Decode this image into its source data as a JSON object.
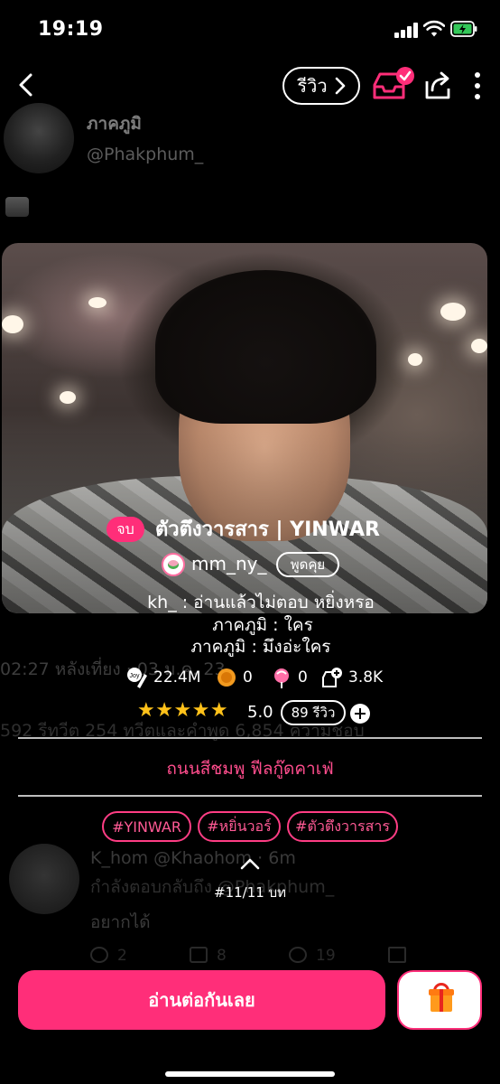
{
  "status_bar": {
    "time": "19:19"
  },
  "nav": {
    "review_label": "รีวิว"
  },
  "background_tweet": {
    "name": "ภาคภูมิ",
    "handle": "@Phakphum_",
    "meta_line": "02:27 หลังเที่ยง · 03 ม.ค. 23",
    "stats_line": "592 รีทวีต  254 ทวีตและคำพูด  6,854 ความชอบ",
    "reply_name": "K_hom @Khaohom · 6m",
    "reply_to": "กำลังตอบกลับถึง @Phakphum_",
    "reply_text": "อยากได้",
    "reply_counts": [
      "2",
      "8",
      "19"
    ]
  },
  "novel": {
    "status_badge": "จบ",
    "title": "ตัวตึงวารสาร | YINWAR",
    "author": "mm_ny_",
    "chat_label": "พูดคุย",
    "dialog": [
      "kh_ : อ่านแล้วไม่ตอบ หยิ่งหรอ",
      "ภาคภูมิ : ใคร",
      "ภาคภูมิ : มึงอ่ะใคร"
    ],
    "stats": {
      "views": "22.4M",
      "coins": "0",
      "candies": "0",
      "library_adds": "3.8K"
    },
    "rating": {
      "stars": "★★★★★",
      "value": "5.0",
      "review_count": "89 รีวิว"
    },
    "subtitle": "ถนนสีชมพู  ฟีลกู๊ดคาเฟ่",
    "tags": [
      "#YINWAR",
      "#หยิ่นวอร์",
      "#ตัวตึงวารสาร"
    ],
    "chapter_count": "#11/11 บท"
  },
  "actions": {
    "read_label": "อ่านต่อกันเลย"
  },
  "colors": {
    "accent": "#ff2e79",
    "tag_text": "#ff5a95",
    "star": "#ffc21a",
    "background": "#000000"
  },
  "icons": [
    "back-icon",
    "chevron-right-icon",
    "library-check-icon",
    "share-icon",
    "more-vertical-icon",
    "views-icon",
    "coin-icon",
    "candy-icon",
    "library-add-icon",
    "plus-icon",
    "chevron-up-icon",
    "gift-icon"
  ]
}
